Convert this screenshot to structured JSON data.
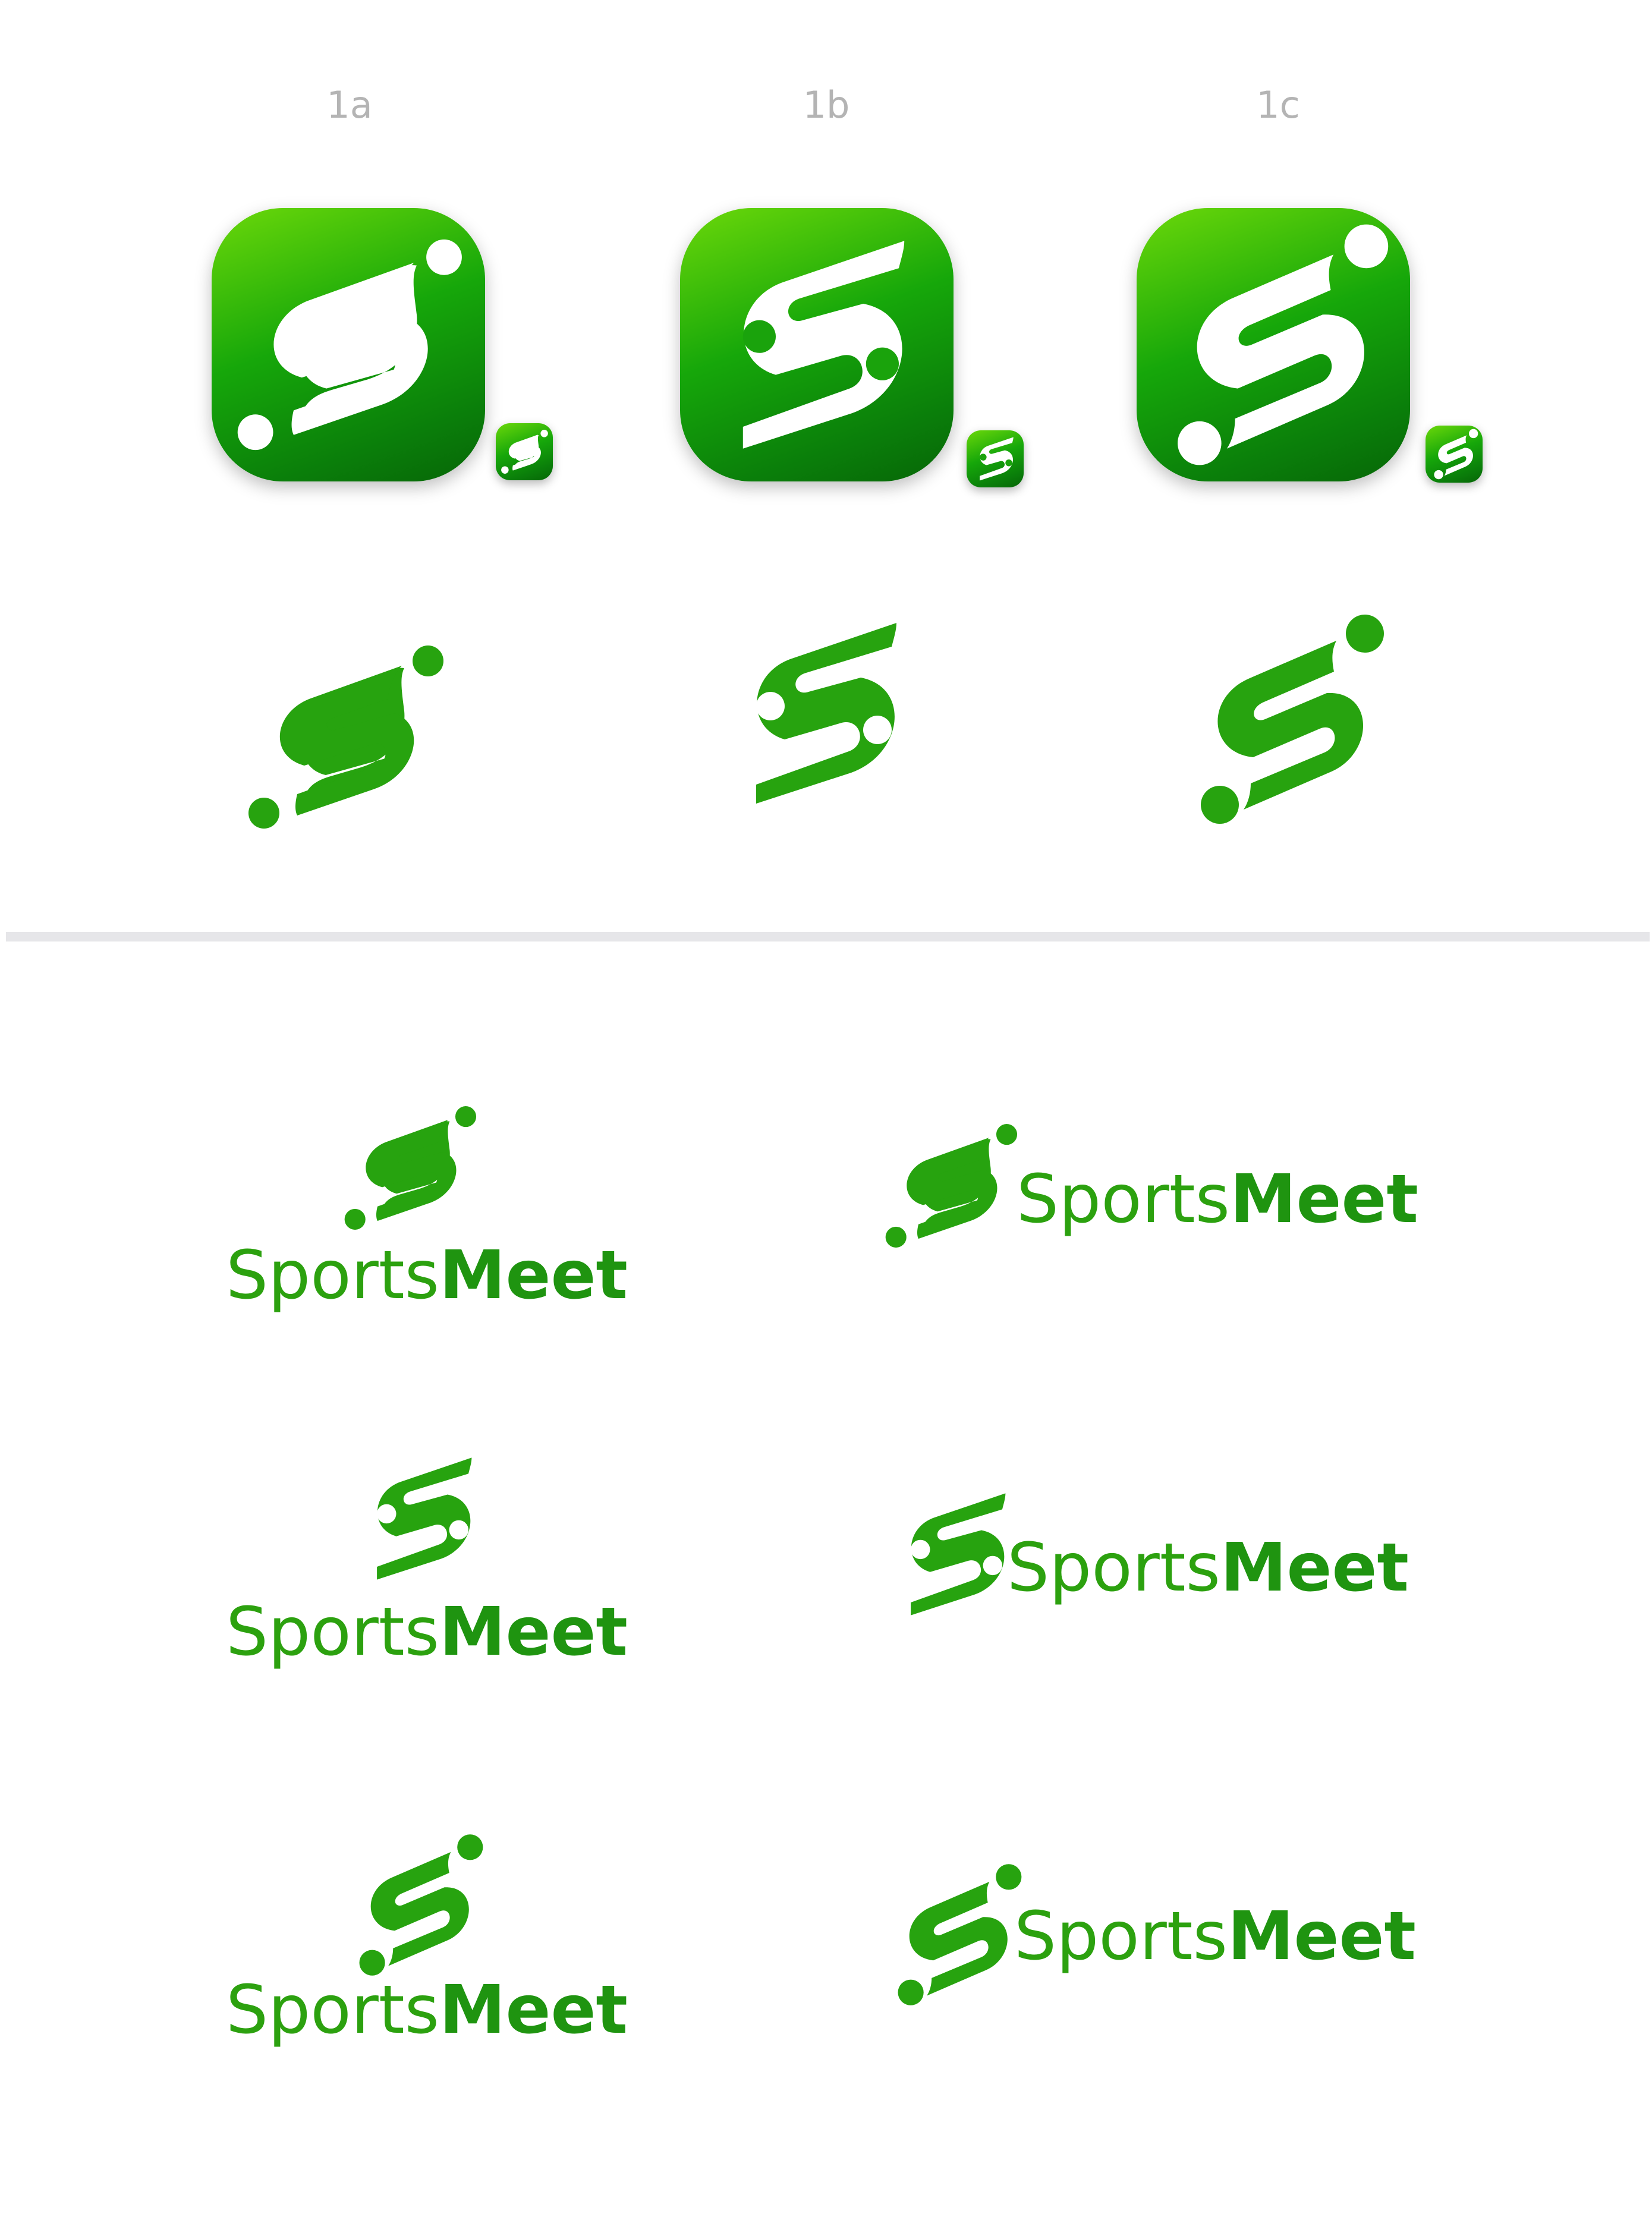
{
  "variants": [
    {
      "label": "1a",
      "mark": "s-mark-1a-icon"
    },
    {
      "label": "1b",
      "mark": "s-mark-1b-icon"
    },
    {
      "label": "1c",
      "mark": "s-mark-1c-icon"
    }
  ],
  "brand": {
    "name_light": "Sports",
    "name_bold": "Meet"
  },
  "lockups": [
    {
      "variant": "1a",
      "stacked_name": "SportsMeet",
      "horizontal_name": "SportsMeet"
    },
    {
      "variant": "1b",
      "stacked_name": "SportsMeet",
      "horizontal_name": "SportsMeet"
    },
    {
      "variant": "1c",
      "stacked_name": "SportsMeet",
      "horizontal_name": "SportsMeet"
    }
  ],
  "colors": {
    "brand_green": "#2ca10f",
    "brand_green_dark": "#1f9410",
    "tile_gradient_top": "#6bd80a",
    "tile_gradient_bottom": "#076607",
    "label_grey": "#b4b4b4",
    "divider": "#e6e6e9"
  }
}
